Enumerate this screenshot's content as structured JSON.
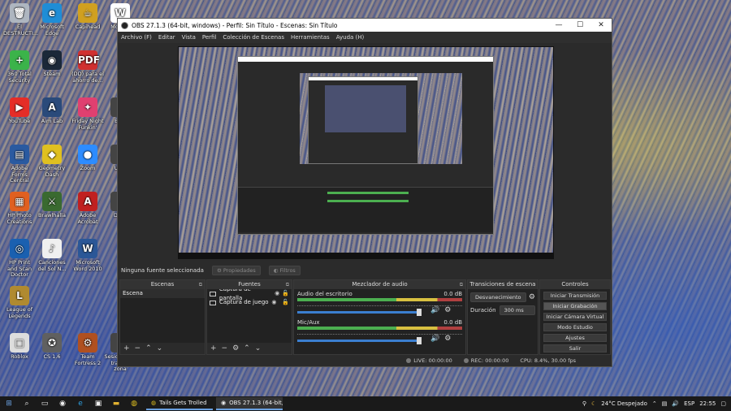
{
  "desktop": {
    "icons": [
      {
        "label": "El DESTRUCTI...",
        "glyph": "🗑",
        "color": "#aeb6c0"
      },
      {
        "label": "Microsoft Edge",
        "glyph": "e",
        "color": "#1f8dd6"
      },
      {
        "label": "Capihead",
        "glyph": "☕",
        "color": "#d0a020"
      },
      {
        "label": "McAfee",
        "glyph": "W",
        "color": "#ffffff"
      },
      {
        "label": "360 Total Security",
        "glyph": "+",
        "color": "#3bb34a"
      },
      {
        "label": "Steam",
        "glyph": "◉",
        "color": "#1b2838"
      },
      {
        "label": "(DD) para el ahorro de...",
        "glyph": "PDF",
        "color": "#d03030"
      },
      {
        "label": "YouTube",
        "glyph": "▶",
        "color": "#e52d27"
      },
      {
        "label": "Aim Lab",
        "glyph": "A",
        "color": "#2a4a7a"
      },
      {
        "label": "Friday Night Funkin'",
        "glyph": "✦",
        "color": "#e04070"
      },
      {
        "label": "Expl",
        "glyph": "",
        "color": "#444"
      },
      {
        "label": "Adobe Forms Central",
        "glyph": "▤",
        "color": "#2a5aa0"
      },
      {
        "label": "Geometry Dash",
        "glyph": "◆",
        "color": "#e0c020"
      },
      {
        "label": "Zoom",
        "glyph": "●",
        "color": "#2d8cff"
      },
      {
        "label": "UND",
        "glyph": "",
        "color": "#444"
      },
      {
        "label": "HP Photo Creations",
        "glyph": "▦",
        "color": "#e06020"
      },
      {
        "label": "Brawlhalla",
        "glyph": "⚔",
        "color": "#3a6a30"
      },
      {
        "label": "Adobe Acrobat",
        "glyph": "A",
        "color": "#c02020"
      },
      {
        "label": "Dicie",
        "glyph": "",
        "color": "#444"
      },
      {
        "label": "HP Print and Scan Doctor",
        "glyph": "◎",
        "color": "#1a60b0"
      },
      {
        "label": "Canciones del Sol N...",
        "glyph": "♪",
        "color": "#f0f0f0"
      },
      {
        "label": "Microsoft Word 2010",
        "glyph": "W",
        "color": "#2b5797"
      },
      {
        "label": "League of Legends",
        "glyph": "L",
        "color": "#b08a30"
      },
      {
        "label": "Roblox",
        "glyph": "□",
        "color": "#dddddd"
      },
      {
        "label": "CS 1.6",
        "glyph": "✪",
        "color": "#606060"
      },
      {
        "label": "Team Fortress 2",
        "glyph": "⚙",
        "color": "#b05020"
      },
      {
        "label": "Sesiones de trabajo zona",
        "glyph": "",
        "color": "#444"
      }
    ]
  },
  "window": {
    "title": "OBS 27.1.3 (64-bit, windows) - Perfil: Sin Título - Escenas: Sin Título",
    "controls": {
      "minimize": "—",
      "maximize": "☐",
      "close": "✕"
    },
    "menu": [
      "Archivo (F)",
      "Editar",
      "Vista",
      "Perfil",
      "Colección de Escenas",
      "Herramientas",
      "Ayuda (H)"
    ]
  },
  "status_line": {
    "no_source": "Ninguna fuente seleccionada",
    "properties": "Propiedades",
    "filters": "Filtros"
  },
  "docks": {
    "scenes": {
      "title": "Escenas",
      "items": [
        "Escena"
      ]
    },
    "sources": {
      "title": "Fuentes",
      "items": [
        "Captura de pantalla",
        "Captura de juego"
      ]
    },
    "mixer": {
      "title": "Mezclador de audio",
      "channels": [
        {
          "name": "Audio del escritorio",
          "db": "0.0 dB"
        },
        {
          "name": "Mic/Aux",
          "db": "0.0 dB"
        }
      ]
    },
    "transitions": {
      "title": "Transiciones de escena",
      "transition": "Desvanecimiento",
      "duration_label": "Duración",
      "duration_value": "300 ms"
    },
    "controls": {
      "title": "Controles",
      "buttons": [
        "Iniciar Transmisión",
        "Iniciar Grabación",
        "Iniciar Cámara Virtual",
        "Modo Estudio",
        "Ajustes",
        "Salir"
      ]
    }
  },
  "statusbar": {
    "live": "LIVE: 00:00:00",
    "rec": "REC: 00:00:00",
    "cpu": "CPU: 8.4%, 30.00 fps"
  },
  "taskbar": {
    "apps": [
      {
        "label": "Tails Gets Trolled",
        "active": false
      },
      {
        "label": "OBS 27.1.3 (64-bit, wi...",
        "active": true
      }
    ],
    "weather": "24°C Despejado",
    "lang": "ESP",
    "time": "22:55"
  }
}
